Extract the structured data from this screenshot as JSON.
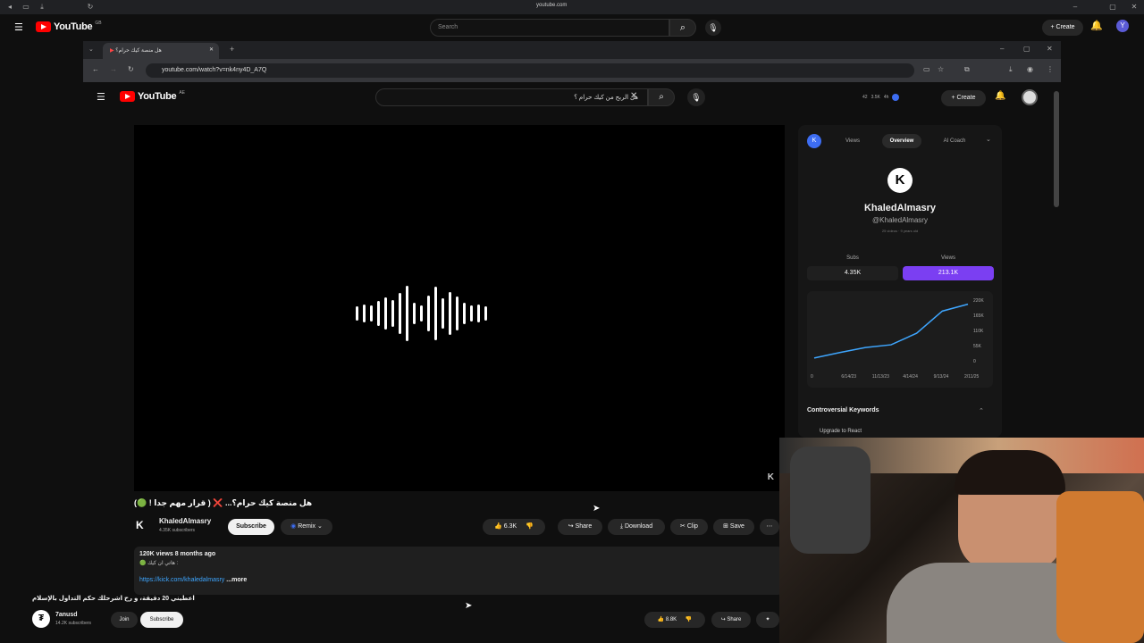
{
  "outer": {
    "os_url": "youtube.com",
    "logo": "YouTube",
    "logo_country": "GB",
    "search_placeholder": "Search",
    "create_label": "Create",
    "avatar_letter": "Y"
  },
  "inner": {
    "tab_title": "هل منصة كيك حرام؟",
    "url": "youtube.com/watch?v=nk4ny4D_A7Q",
    "logo": "YouTube",
    "logo_country": "AE",
    "search_query": "هل الربح من كيك حرام ؟",
    "create_label": "Create",
    "ext_stats": [
      "42",
      "3.5K",
      "4h"
    ]
  },
  "video": {
    "title": "هل منصة كيك حرام؟... ❌ ( قرار مهم جدا ! 🟢)",
    "channel_name": "KhaledAlmasry",
    "subscribers": "4.35K subscribers",
    "subscribe_label": "Subscribe",
    "remix_label": "Remix",
    "likes": "6.3K",
    "share_label": "Share",
    "download_label": "Download",
    "clip_label": "Clip",
    "save_label": "Save",
    "views_date": "120K views  8 months ago",
    "desc_line": "🟢 هاتي ان كيك :",
    "desc_link": "https://kick.com/khaledalmasry",
    "more_label": "...more"
  },
  "panel": {
    "tabs": [
      "Views",
      "Overview",
      "AI Coach"
    ],
    "active_tab": "Overview",
    "channel_name": "KhaledAlmasry",
    "handle": "@KhaledAlmasry",
    "meta": "25 videos · 9 years old",
    "subs_label": "Subs",
    "subs_value": "4.35K",
    "views_label": "Views",
    "views_value": "213.1K",
    "keywords_title": "Controversial Keywords",
    "keywords_peek": "Upgrade to React",
    "accent": "#7b3ff2"
  },
  "chart_data": {
    "type": "line",
    "x": [
      "0",
      "6/14/23",
      "11/13/23",
      "4/14/24",
      "9/13/24",
      "2/11/25"
    ],
    "y_ticks": [
      "0",
      "55K",
      "110K",
      "165K",
      "220K"
    ],
    "series": [
      {
        "values": [
          10000,
          30000,
          48000,
          58000,
          100000,
          180000,
          205000
        ]
      }
    ],
    "ylim": [
      0,
      220000
    ],
    "grid": false
  },
  "bottom": {
    "title": "اعطيني 20 دقيقة، و رح اشرحلك حكم التداول بالإسلام",
    "channel_name": "7anusd",
    "subscribers": "14.2K subscribers",
    "join_label": "Join",
    "subscribe_label": "Subscribe",
    "likes": "8.8K",
    "share_label": "Share"
  }
}
